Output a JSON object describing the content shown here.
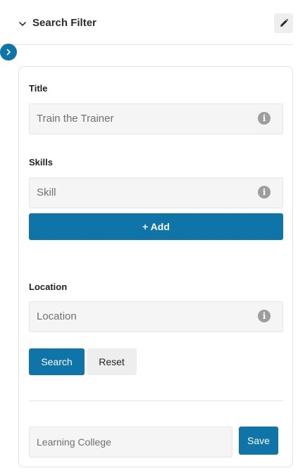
{
  "header": {
    "title": "Search Filter",
    "chevron_icon": "chevron-down-icon",
    "edit_icon": "pencil-icon"
  },
  "sidebar_toggle": {
    "icon": "chevron-right-icon"
  },
  "form": {
    "title": {
      "label": "Title",
      "placeholder": "Train the Trainer",
      "info_icon": "info-icon"
    },
    "skills": {
      "label": "Skills",
      "placeholder": "Skill",
      "info_icon": "info-icon",
      "add_label": "+ Add"
    },
    "location": {
      "label": "Location",
      "placeholder": "Location",
      "info_icon": "info-icon"
    },
    "search_label": "Search",
    "reset_label": "Reset"
  },
  "saved_search": {
    "value": "Learning College",
    "save_label": "Save"
  },
  "colors": {
    "primary": "#0f74a8",
    "field_bg": "#f5f5f5",
    "secondary_btn": "#eeeeee"
  }
}
